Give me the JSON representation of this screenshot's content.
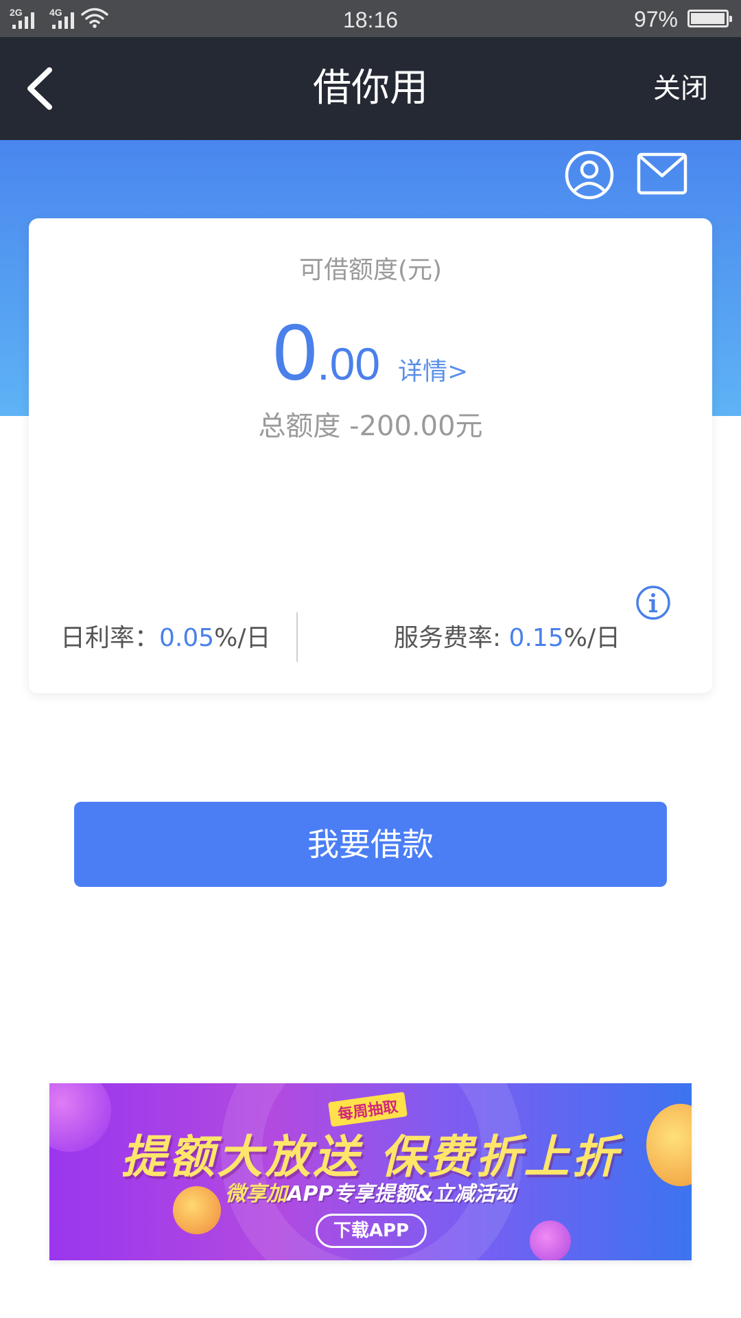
{
  "status_bar": {
    "signal_1_label": "2G",
    "signal_2_label": "4G",
    "time": "18:16",
    "battery_percent": "97%",
    "battery_level": 0.97
  },
  "nav": {
    "title": "借你用",
    "close_label": "关闭",
    "back_icon": "chevron-left-icon"
  },
  "header_icons": [
    "user-icon",
    "mail-icon"
  ],
  "card": {
    "label": "可借额度(元)",
    "amount_int": "0",
    "amount_dec": ".00",
    "detail_link": "详情>",
    "total_line": "总额度 -200.00元",
    "daily_rate_label": "日利率：",
    "daily_rate_value": "0.05",
    "daily_rate_unit": "%/日",
    "service_rate_label": "服务费率: ",
    "service_rate_value": "0.15",
    "service_rate_unit": "%/日",
    "info_icon": "info-icon"
  },
  "borrow_button": "我要借款",
  "banner": {
    "tag": "每周抽取",
    "headline": "提额大放送  保费折上折",
    "sub_highlight": "微享加",
    "sub_rest": "APP专享提额&立减活动",
    "button": "下载APP"
  },
  "colors": {
    "nav_bg": "#252933",
    "status_bg": "#4a4b4f",
    "accent_blue": "#4a80ea",
    "button_blue": "#4b7ef5"
  }
}
